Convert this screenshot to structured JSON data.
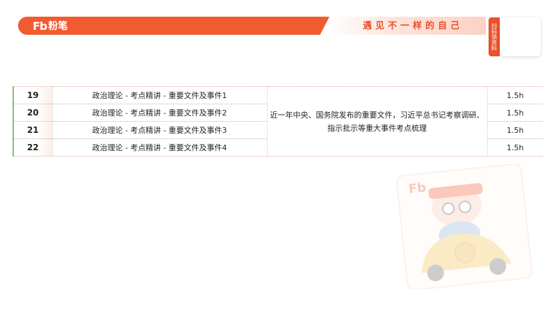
{
  "header": {
    "logo_mark": "Fb",
    "logo_name": "粉笔",
    "slogan": "遇见不一样的自己",
    "qr_tag": "扫码领资料"
  },
  "table": {
    "rows": [
      {
        "num": "19",
        "title": "政治理论 - 考点精讲 - 重要文件及事件1",
        "duration": "1.5h"
      },
      {
        "num": "20",
        "title": "政治理论 - 考点精讲 - 重要文件及事件2",
        "duration": "1.5h"
      },
      {
        "num": "21",
        "title": "政治理论 - 考点精讲 - 重要文件及事件3",
        "duration": "1.5h"
      },
      {
        "num": "22",
        "title": "政治理论 - 考点精讲 - 重要文件及事件4",
        "duration": "1.5h"
      }
    ],
    "description": "近一年中央、国务院发布的重要文件，习近平总书记考察调研、指示批示等重大事件考点梳理"
  },
  "colors": {
    "brand": "#f25a2f",
    "accent_left_border": "#86c07a"
  }
}
